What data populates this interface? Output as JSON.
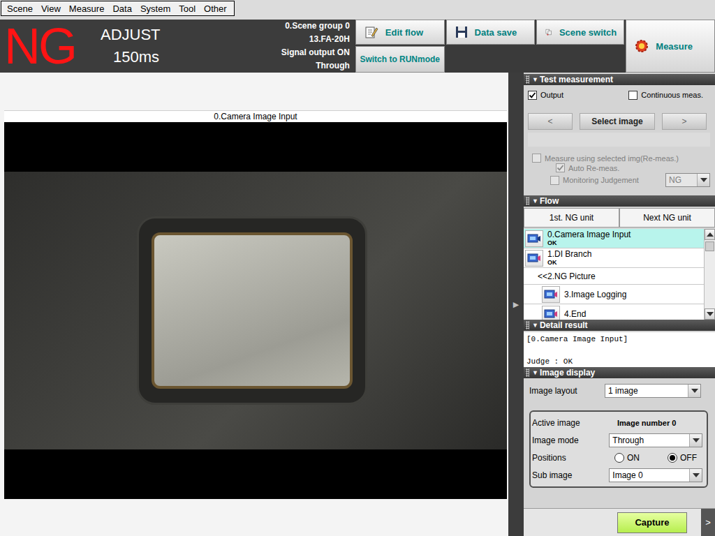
{
  "menu": [
    "Scene",
    "View",
    "Measure",
    "Data",
    "System",
    "Tool",
    "Other"
  ],
  "status": {
    "judgement": "NG",
    "mode": "ADJUST",
    "time": "150ms",
    "info": [
      "0.Scene group 0",
      "13.FA-20H",
      "Signal output ON",
      "Through"
    ]
  },
  "toolbar": {
    "edit_flow": "Edit flow",
    "run_mode": "Switch to RUNmode",
    "data_save": "Data save",
    "scene_switch": "Scene switch",
    "measure": "Measure"
  },
  "image_panel": {
    "title": "0.Camera Image Input"
  },
  "panel_toggle": "▶",
  "test_measurement": {
    "title": "Test measurement",
    "icon": "▼",
    "expanded": true,
    "output": {
      "label": "Output",
      "checked": true,
      "disabled": false
    },
    "continuous": {
      "label": "Continuous meas.",
      "checked": false,
      "disabled": false
    },
    "prev": "<",
    "select": "Select image",
    "next": ">",
    "remeasure": {
      "label": "Measure using selected img(Re-meas.)",
      "checked": false,
      "disabled": true
    },
    "auto_remeasure": {
      "label": "Auto Re-meas.",
      "checked": true,
      "disabled": true
    },
    "monitoring": {
      "label": "Monitoring Judgement",
      "checked": false,
      "disabled": true,
      "value": "NG"
    }
  },
  "flow": {
    "title": "Flow",
    "icon": "▼",
    "expanded": true,
    "buttons": [
      "1st. NG unit",
      "Next NG unit"
    ],
    "items": [
      {
        "label": "0.Camera Image Input",
        "result": "OK",
        "kind": "unit",
        "nested": false,
        "selected": true
      },
      {
        "label": "1.DI Branch",
        "result": "OK",
        "kind": "unit",
        "nested": false,
        "selected": false
      },
      {
        "label": "<<2.NG Picture",
        "kind": "branch",
        "nested": false,
        "selected": false
      },
      {
        "label": "3.Image Logging",
        "kind": "unit",
        "nested": true,
        "selected": false
      },
      {
        "label": "4.End",
        "kind": "unit",
        "nested": true,
        "selected": false
      }
    ]
  },
  "detail_result": {
    "title": "Detail result",
    "icon": "▼",
    "expanded": true,
    "lines": [
      "[0.Camera Image Input]",
      "Judge : OK"
    ]
  },
  "image_display": {
    "title": "Image display",
    "icon": "▼",
    "expanded": true,
    "layout": {
      "label": "Image layout",
      "value": "1 image"
    },
    "active_image": {
      "label": "Active image",
      "value": "Image number 0"
    },
    "image_mode": {
      "label": "Image mode",
      "value": "Through"
    },
    "positions": {
      "label": "Positions",
      "options": [
        {
          "label": "ON",
          "selected": false
        },
        {
          "label": "OFF",
          "selected": true
        }
      ]
    },
    "sub_image": {
      "label": "Sub image",
      "value": "Image 0"
    }
  },
  "capture": "Capture",
  "more": ">"
}
